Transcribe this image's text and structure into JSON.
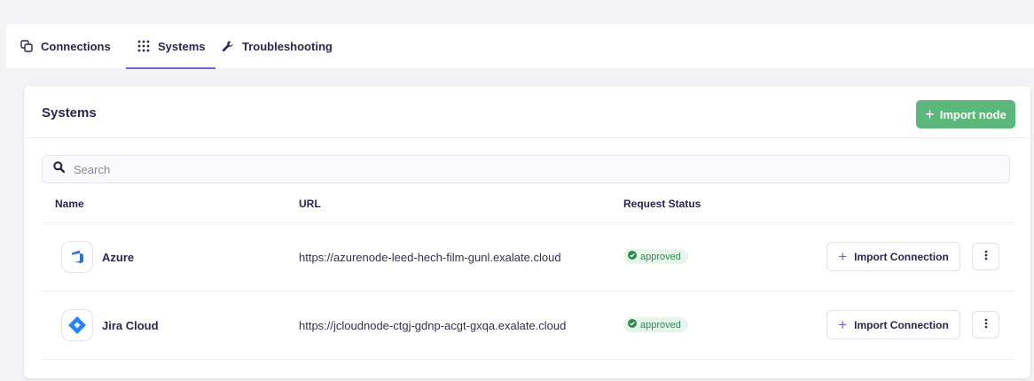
{
  "tabs": [
    {
      "label": "Connections",
      "icon": "connections-icon"
    },
    {
      "label": "Systems",
      "icon": "grid-icon",
      "active": true
    },
    {
      "label": "Troubleshooting",
      "icon": "wrench-icon"
    }
  ],
  "card": {
    "title": "Systems",
    "import_node_label": "Import node"
  },
  "search": {
    "placeholder": "Search",
    "value": ""
  },
  "table": {
    "headers": {
      "name": "Name",
      "url": "URL",
      "status": "Request Status"
    },
    "rows": [
      {
        "name": "Azure",
        "icon": "azure-devops-icon",
        "url": "https://azurenode-leed-hech-film-gunl.exalate.cloud",
        "status": "approved",
        "action_label": "Import Connection"
      },
      {
        "name": "Jira Cloud",
        "icon": "jira-icon",
        "url": "https://jcloudnode-ctgj-gdnp-acgt-gxqa.exalate.cloud",
        "status": "approved",
        "action_label": "Import Connection"
      }
    ]
  },
  "colors": {
    "accent": "#7b5fd6",
    "primary_button": "#5cb87a",
    "approved_bg": "#e6f4ea",
    "approved_text": "#2f8a50",
    "azure_blue": "#2f6fd8",
    "jira_blue": "#2684ff"
  }
}
